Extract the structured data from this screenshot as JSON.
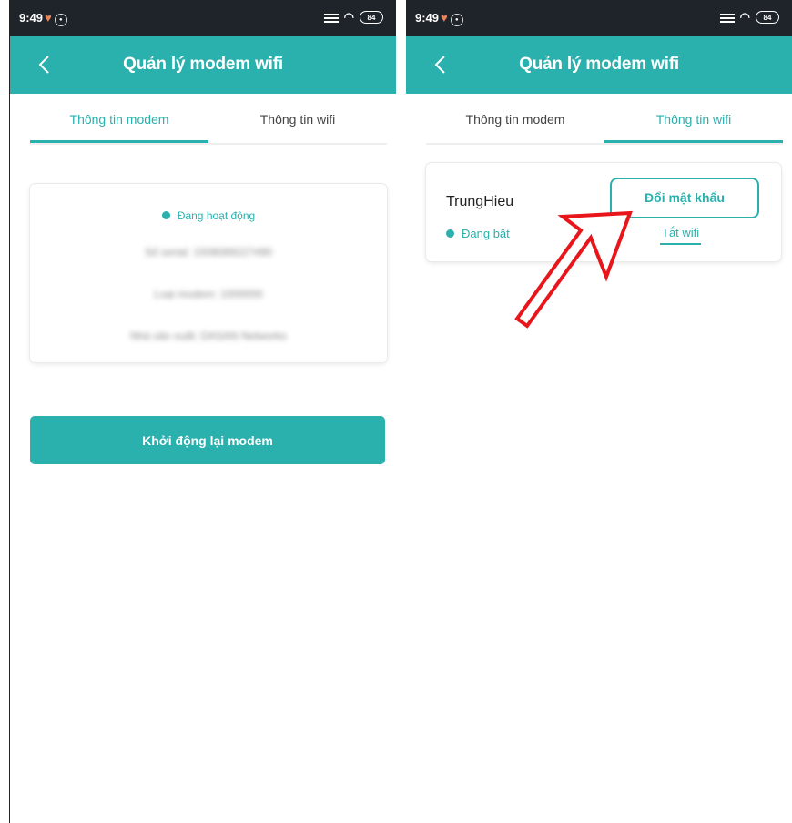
{
  "left_screen": {
    "status_bar": {
      "time": "9:49",
      "battery": "84"
    },
    "app_bar": {
      "title": "Quản lý modem wifi"
    },
    "tabs": [
      {
        "label": "Thông tin modem",
        "active": true
      },
      {
        "label": "Thông tin wifi",
        "active": false
      }
    ],
    "modem_card": {
      "status": "Đang hoạt động",
      "blurred_lines": [
        "Số serial: 1508089227490",
        "Loại modem: 1000000",
        "Nhà sản xuất: DASAN Networks"
      ]
    },
    "restart_button": "Khởi động lại modem"
  },
  "right_screen": {
    "status_bar": {
      "time": "9:49",
      "battery": "84"
    },
    "app_bar": {
      "title": "Quản lý modem wifi"
    },
    "tabs": [
      {
        "label": "Thông tin modem",
        "active": false
      },
      {
        "label": "Thông tin wifi",
        "active": true
      }
    ],
    "wifi_card": {
      "name": "TrungHieu",
      "status": "Đang bật",
      "change_password": "Đổi mật khẩu",
      "turn_off": "Tắt wifi"
    }
  },
  "colors": {
    "accent": "#2ab0ad",
    "status_bar": "#1f242a",
    "arrow": "#e8161b"
  },
  "icons": [
    "back-arrow-icon",
    "heart-icon",
    "signal-icon",
    "wifi-icon",
    "battery-icon",
    "status-dot-icon"
  ]
}
